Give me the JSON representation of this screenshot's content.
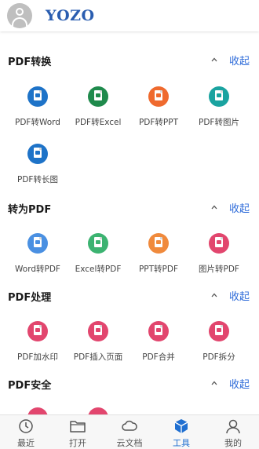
{
  "header": {
    "brand": "YOZO"
  },
  "colors": {
    "blue": "#1e73c8",
    "green": "#1f8a4c",
    "orange": "#ef6a2e",
    "teal": "#1aa3a0",
    "pink": "#e2466e",
    "accent": "#2d6bd9"
  },
  "sections": [
    {
      "title": "PDF转换",
      "collapse": "收起",
      "tools": [
        {
          "label": "PDF转Word",
          "icon": "pdf-to-word-icon"
        },
        {
          "label": "PDF转Excel",
          "icon": "pdf-to-excel-icon"
        },
        {
          "label": "PDF转PPT",
          "icon": "pdf-to-ppt-icon"
        },
        {
          "label": "PDF转图片",
          "icon": "pdf-to-image-icon"
        },
        {
          "label": "PDF转长图",
          "icon": "pdf-to-long-image-icon"
        }
      ]
    },
    {
      "title": "转为PDF",
      "collapse": "收起",
      "tools": [
        {
          "label": "Word转PDF",
          "icon": "word-to-pdf-icon"
        },
        {
          "label": "Excel转PDF",
          "icon": "excel-to-pdf-icon"
        },
        {
          "label": "PPT转PDF",
          "icon": "ppt-to-pdf-icon"
        },
        {
          "label": "图片转PDF",
          "icon": "image-to-pdf-icon"
        }
      ]
    },
    {
      "title": "PDF处理",
      "collapse": "收起",
      "tools": [
        {
          "label": "PDF加水印",
          "icon": "pdf-watermark-icon"
        },
        {
          "label": "PDF插入页面",
          "icon": "pdf-insert-page-icon"
        },
        {
          "label": "PDF合并",
          "icon": "pdf-merge-icon"
        },
        {
          "label": "PDF拆分",
          "icon": "pdf-split-icon"
        }
      ]
    },
    {
      "title": "PDF安全",
      "collapse": "收起",
      "tools": []
    }
  ],
  "tabs": [
    {
      "label": "最近",
      "icon": "clock-icon"
    },
    {
      "label": "打开",
      "icon": "folder-icon"
    },
    {
      "label": "云文档",
      "icon": "cloud-icon"
    },
    {
      "label": "工具",
      "icon": "tools-cube-icon",
      "active": true
    },
    {
      "label": "我的",
      "icon": "user-icon"
    }
  ]
}
